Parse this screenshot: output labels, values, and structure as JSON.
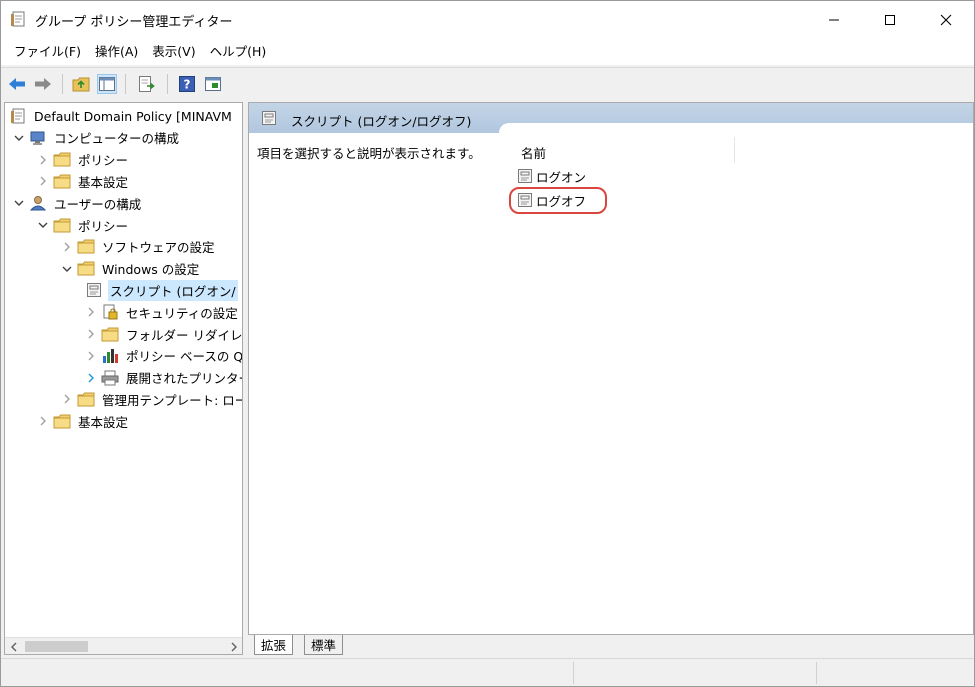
{
  "window": {
    "title": "グループ ポリシー管理エディター",
    "controls": {
      "minimize": "—",
      "maximize": "☐",
      "close": "✕"
    }
  },
  "menu": [
    {
      "label": "ファイル(F)"
    },
    {
      "label": "操作(A)"
    },
    {
      "label": "表示(V)"
    },
    {
      "label": "ヘルプ(H)"
    }
  ],
  "toolbar": [
    {
      "name": "back-button",
      "icon": "arrow-left-icon"
    },
    {
      "name": "forward-button",
      "icon": "arrow-right-icon"
    },
    {
      "name": "up-folder-button",
      "icon": "folder-up-icon"
    },
    {
      "name": "show-hide-tree-button",
      "icon": "console-tree-icon"
    },
    {
      "name": "export-list-button",
      "icon": "export-icon"
    },
    {
      "name": "help-button",
      "icon": "help-icon"
    },
    {
      "name": "properties-button",
      "icon": "properties-icon"
    }
  ],
  "tree": {
    "items": [
      {
        "label": "Default Domain Policy [MINAVM",
        "icon": "policy-doc-icon",
        "caret": ""
      },
      {
        "label": "コンピューターの構成",
        "icon": "computer-icon",
        "caret": "expanded"
      },
      {
        "label": "ポリシー",
        "icon": "folder-icon",
        "caret": "collapsed"
      },
      {
        "label": "基本設定",
        "icon": "folder-icon",
        "caret": "collapsed"
      },
      {
        "label": "ユーザーの構成",
        "icon": "user-icon",
        "caret": "expanded"
      },
      {
        "label": "ポリシー",
        "icon": "folder-icon",
        "caret": "expanded"
      },
      {
        "label": "ソフトウェアの設定",
        "icon": "folder-icon",
        "caret": "collapsed"
      },
      {
        "label": "Windows の設定",
        "icon": "folder-icon",
        "caret": "expanded"
      },
      {
        "label": "スクリプト (ログオン/",
        "icon": "script-icon",
        "caret": "",
        "selected": true
      },
      {
        "label": "セキュリティの設定",
        "icon": "security-icon",
        "caret": "collapsed"
      },
      {
        "label": "フォルダー リダイレク",
        "icon": "folder-icon",
        "caret": "collapsed"
      },
      {
        "label": "ポリシー ベースの Q",
        "icon": "chart-icon",
        "caret": "collapsed"
      },
      {
        "label": "展開されたプリンター",
        "icon": "printer-icon",
        "caret": "collapsed-blue"
      },
      {
        "label": "管理用テンプレート: ロー",
        "icon": "folder-icon",
        "caret": "collapsed"
      },
      {
        "label": "基本設定",
        "icon": "folder-icon",
        "caret": "collapsed"
      }
    ]
  },
  "details": {
    "header": "スクリプト (ログオン/ログオフ)",
    "description": "項目を選択すると説明が表示されます。",
    "column_name": "名前",
    "items": [
      {
        "label": "ログオン",
        "icon": "script-icon"
      },
      {
        "label": "ログオフ",
        "icon": "script-icon",
        "highlighted": true
      }
    ]
  },
  "tabs": [
    {
      "label": "拡張",
      "active": true
    },
    {
      "label": "標準",
      "active": false
    }
  ],
  "colors": {
    "selection": "#cce8ff",
    "header_band": "#b9cde3",
    "highlight": "#d9453f"
  }
}
